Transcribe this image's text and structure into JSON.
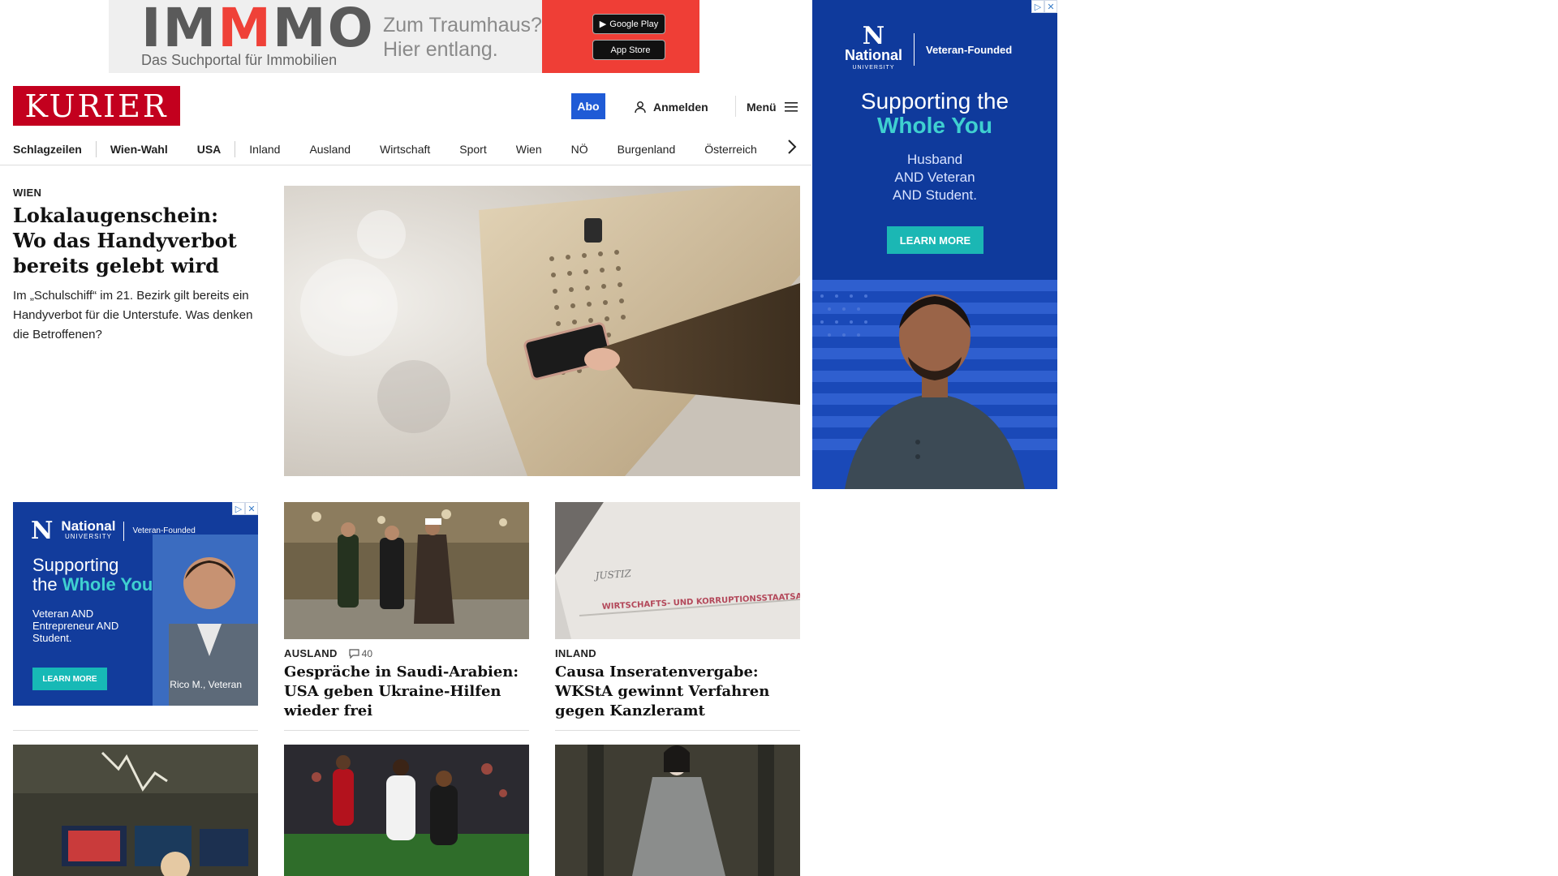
{
  "top_ad": {
    "brand_part1": "IM",
    "brand_part2": "M",
    "brand_part3": "MO",
    "subline": "Das Suchportal für Immobilien",
    "tagline": "Zum Traumhaus? Hier entlang.",
    "google_play": "Google Play",
    "app_store": "App Store"
  },
  "header": {
    "logo": "KURIER",
    "abo": "Abo",
    "login": "Anmelden",
    "menu": "Menü"
  },
  "nav": {
    "items": [
      "Schlagzeilen",
      "Wien-Wahl",
      "USA",
      "Inland",
      "Ausland",
      "Wirtschaft",
      "Sport",
      "Wien",
      "NÖ",
      "Burgenland",
      "Österreich"
    ]
  },
  "lead": {
    "section": "WIEN",
    "title": "Lokalaugenschein: Wo das Handyverbot bereits gelebt wird",
    "teaser": "Im „Schulschiff“ im 21. Bezirk gilt bereits ein Handyverbot für die Unterstufe. Was denken die Betroffenen?"
  },
  "cards": [
    {
      "section": "AUSLAND",
      "comments": "40",
      "title": "Gespräche in Saudi-Arabien: USA geben Ukraine-Hilfen wieder frei"
    },
    {
      "section": "INLAND",
      "title": "Causa Inseratenvergabe: WKStA gewinnt Verfahren gegen Kanzleramt",
      "image_text": "WIRTSCHAFTS- UND KORRUPTIONSSTAATSANWALTSCHAFT"
    }
  ],
  "ad_small": {
    "org": "National",
    "org_sub": "UNIVERSITY",
    "founded": "Veteran-Founded",
    "headline_1": "Supporting",
    "headline_2": "the",
    "headline_3": "Whole You",
    "body": "Veteran AND Entrepreneur AND Student.",
    "cta": "LEARN MORE",
    "caption": "Rico M., Veteran"
  },
  "sky_ad": {
    "org": "National",
    "org_sub": "UNIVERSITY",
    "founded": "Veteran-Founded",
    "headline_1": "Supporting the",
    "headline_2": "Whole You",
    "body_1": "Husband",
    "body_2": "AND Veteran",
    "body_3": "AND Student.",
    "cta": "LEARN MORE"
  },
  "colors": {
    "brand_red": "#c3001e",
    "abo_blue": "#1f5bd6",
    "ad_blue": "#0f3a9c",
    "ad_teal": "#3fd0d0"
  }
}
